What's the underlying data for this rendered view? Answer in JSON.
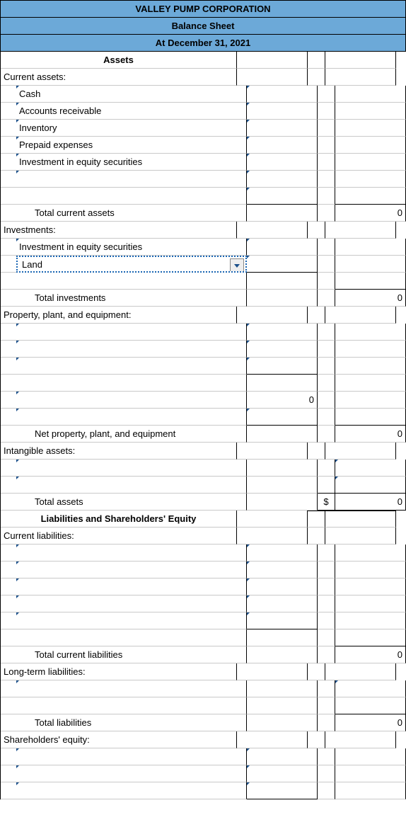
{
  "header": {
    "company": "VALLEY PUMP CORPORATION",
    "title": "Balance Sheet",
    "date": "At December 31, 2021"
  },
  "sections": {
    "assets": "Assets",
    "liab_eq": "Liabilities and Shareholders' Equity"
  },
  "labels": {
    "current_assets": "Current assets:",
    "cash": "Cash",
    "ar": "Accounts receivable",
    "inventory": "Inventory",
    "prepaid": "Prepaid expenses",
    "inv_eq_sec1": "Investment in equity securities",
    "total_current_assets": "Total current assets",
    "investments": "Investments:",
    "inv_eq_sec2": "Investment in equity securities",
    "land": "Land",
    "total_investments": "Total investments",
    "ppe": "Property, plant, and equipment:",
    "net_ppe": "Net property, plant, and equipment",
    "intangible": "Intangible assets:",
    "total_assets": "Total assets",
    "current_liab": "Current liabilities:",
    "total_current_liab": "Total current liabilities",
    "lt_liab": "Long-term liabilities:",
    "total_liab": "Total liabilities",
    "sh_equity": "Shareholders' equity:"
  },
  "values": {
    "zero": "0",
    "dollar": "$",
    "ppe_sub": "0",
    "total_current_assets": "0",
    "total_investments": "0",
    "net_ppe": "0",
    "total_assets": "0",
    "total_current_liab": "0",
    "total_liab": "0"
  }
}
